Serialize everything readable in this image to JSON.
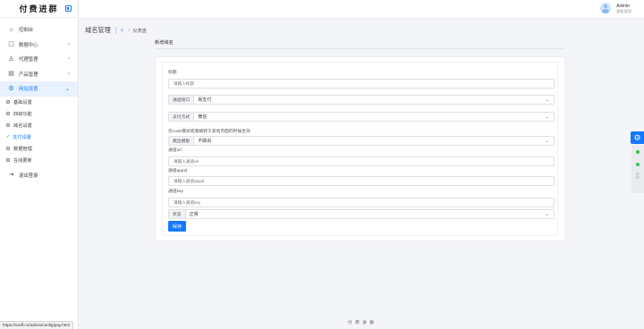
{
  "brand": {
    "name": "付费进群"
  },
  "sidebar": {
    "items": [
      {
        "icon": "dashboard-icon",
        "label": "控制台"
      },
      {
        "icon": "data-icon",
        "label": "数据中心"
      },
      {
        "icon": "agent-icon",
        "label": "代理管理"
      },
      {
        "icon": "product-icon",
        "label": "产品管理"
      },
      {
        "icon": "gear-icon",
        "label": "网站设置"
      }
    ],
    "sub_items": [
      "基础设置",
      "四级功能",
      "域名设置",
      "支付设置",
      "数据管理",
      "在线更新"
    ],
    "logout_label": "退出登录"
  },
  "user": {
    "name": "Admin",
    "role": "超级管理"
  },
  "breadcrumb": {
    "title": "域名管理",
    "current": "仪表盘"
  },
  "section": {
    "title": "新增域名"
  },
  "form": {
    "title_label": "标题",
    "title_placeholder": "请输入标题",
    "channel_addon": "通道接口",
    "channel_value": "易支付",
    "pay_method_addon": "支付方式",
    "pay_method_value": "微信",
    "note_label": "仅code模式或者跳转于其他页面的时候生效",
    "jump_addon": "跳出模板",
    "jump_value": "不跳出",
    "url_label": "通道url",
    "url_placeholder": "请输入通道url",
    "appid_label": "通道appid",
    "appid_placeholder": "请输入通道appid",
    "key_label": "通道key",
    "key_placeholder": "请输入通道key",
    "status_addon": "状态",
    "status_value": "正常",
    "save_label": "保存"
  },
  "footer": {
    "text": "付 费 进 群"
  },
  "status_bar": {
    "url": "https://xxxff.cn/admin/config/pay.html"
  },
  "colors": {
    "accent": "#1677ff",
    "online": "#39c15b"
  }
}
